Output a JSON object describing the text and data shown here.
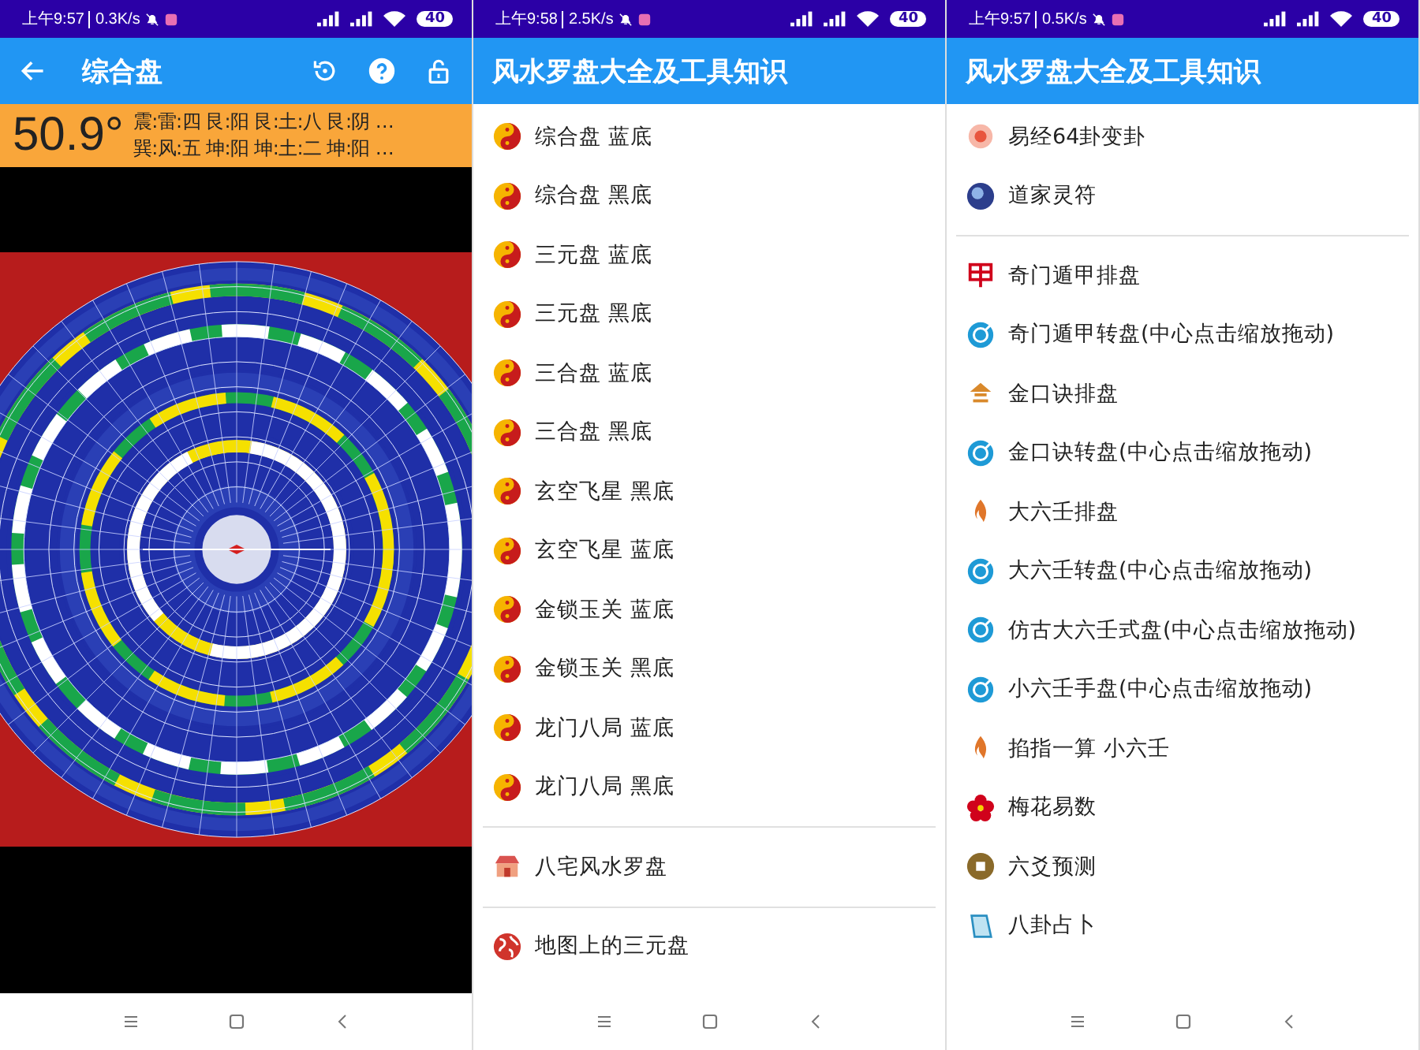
{
  "panels": [
    {
      "kind": "compass",
      "status": {
        "time": "上午9:57",
        "speed": "0.3K/s",
        "battery": "40"
      },
      "header": {
        "title": "综合盘"
      },
      "reading": {
        "degrees": "50.9°",
        "lines": [
          "震:雷:四 艮:阳 艮:土:八 艮:阴 …",
          "巽:风:五  坤:阳  坤:土:二  坤:阳 …"
        ]
      }
    },
    {
      "kind": "list",
      "status": {
        "time": "上午9:58",
        "speed": "2.5K/s",
        "battery": "40"
      },
      "header": {
        "title": "风水罗盘大全及工具知识"
      },
      "groups": [
        [
          {
            "kind": "taiji",
            "label": "综合盘  蓝底"
          },
          {
            "kind": "taiji",
            "label": "综合盘  黑底"
          },
          {
            "kind": "taiji",
            "label": "三元盘  蓝底"
          },
          {
            "kind": "taiji",
            "label": "三元盘  黑底"
          },
          {
            "kind": "taiji",
            "label": "三合盘  蓝底"
          },
          {
            "kind": "taiji",
            "label": "三合盘  黑底"
          },
          {
            "kind": "taiji",
            "label": "玄空飞星  黑底"
          },
          {
            "kind": "taiji",
            "label": "玄空飞星  蓝底"
          },
          {
            "kind": "taiji",
            "label": "金锁玉关  蓝底"
          },
          {
            "kind": "taiji",
            "label": "金锁玉关  黑底"
          },
          {
            "kind": "taiji",
            "label": "龙门八局  蓝底"
          },
          {
            "kind": "taiji",
            "label": "龙门八局  黑底"
          }
        ],
        [
          {
            "kind": "house",
            "label": "八宅风水罗盘"
          }
        ],
        [
          {
            "kind": "globe",
            "label": "地图上的三元盘"
          }
        ]
      ]
    },
    {
      "kind": "list",
      "status": {
        "time": "上午9:57",
        "speed": "0.5K/s",
        "battery": "40"
      },
      "header": {
        "title": "风水罗盘大全及工具知识"
      },
      "groups": [
        [
          {
            "kind": "sun",
            "label": "易经64卦变卦"
          },
          {
            "kind": "orb",
            "label": "道家灵符"
          }
        ],
        [
          {
            "kind": "seal",
            "label": "奇门遁甲排盘"
          },
          {
            "kind": "target",
            "label": "奇门遁甲转盘(中心点击缩放拖动)"
          },
          {
            "kind": "ingot",
            "label": "金口诀排盘"
          },
          {
            "kind": "target",
            "label": "金口诀转盘(中心点击缩放拖动)"
          },
          {
            "kind": "flame",
            "label": "大六壬排盘"
          },
          {
            "kind": "target",
            "label": "大六壬转盘(中心点击缩放拖动)"
          },
          {
            "kind": "target",
            "label": "仿古大六壬式盘(中心点击缩放拖动)"
          },
          {
            "kind": "target",
            "label": "小六壬手盘(中心点击缩放拖动)"
          },
          {
            "kind": "flame",
            "label": "掐指一算 小六壬"
          },
          {
            "kind": "plum",
            "label": "梅花易数"
          },
          {
            "kind": "coin",
            "label": "六爻预测"
          },
          {
            "kind": "book",
            "label": "八卦占卜"
          }
        ]
      ]
    }
  ]
}
